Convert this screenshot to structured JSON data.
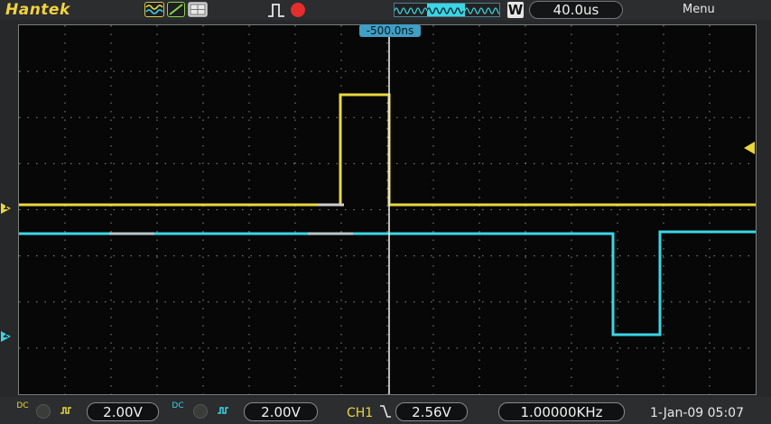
{
  "header": {
    "brand": "Hantek",
    "timebase": "40.0us",
    "acq_mode_badge": "W",
    "menu_label": "Menu",
    "trigger_position": "-500.0ns",
    "icons": [
      "waveform-display-icon",
      "line-display-icon",
      "grid-display-icon",
      "pulse-trigger-icon",
      "run-indicator-icon"
    ]
  },
  "channels": {
    "ch1": {
      "marker": "1",
      "coupling": "DC",
      "volts_div": "2.00V",
      "color": "#e9d83d"
    },
    "ch2": {
      "marker": "2",
      "coupling": "DC",
      "volts_div": "2.00V",
      "color": "#3ad6e6"
    }
  },
  "trigger": {
    "source": "CH1",
    "level": "2.56V",
    "slope": "falling"
  },
  "measurements": {
    "frequency": "1.00000KHz"
  },
  "datetime": "1-Jan-09 05:07",
  "colors": {
    "ch1": "#e9d83d",
    "ch2": "#3ad6e6",
    "grid": "#8a8f8a",
    "run": "#e52d2d",
    "trigger_marker": "#3f9fc4"
  }
}
